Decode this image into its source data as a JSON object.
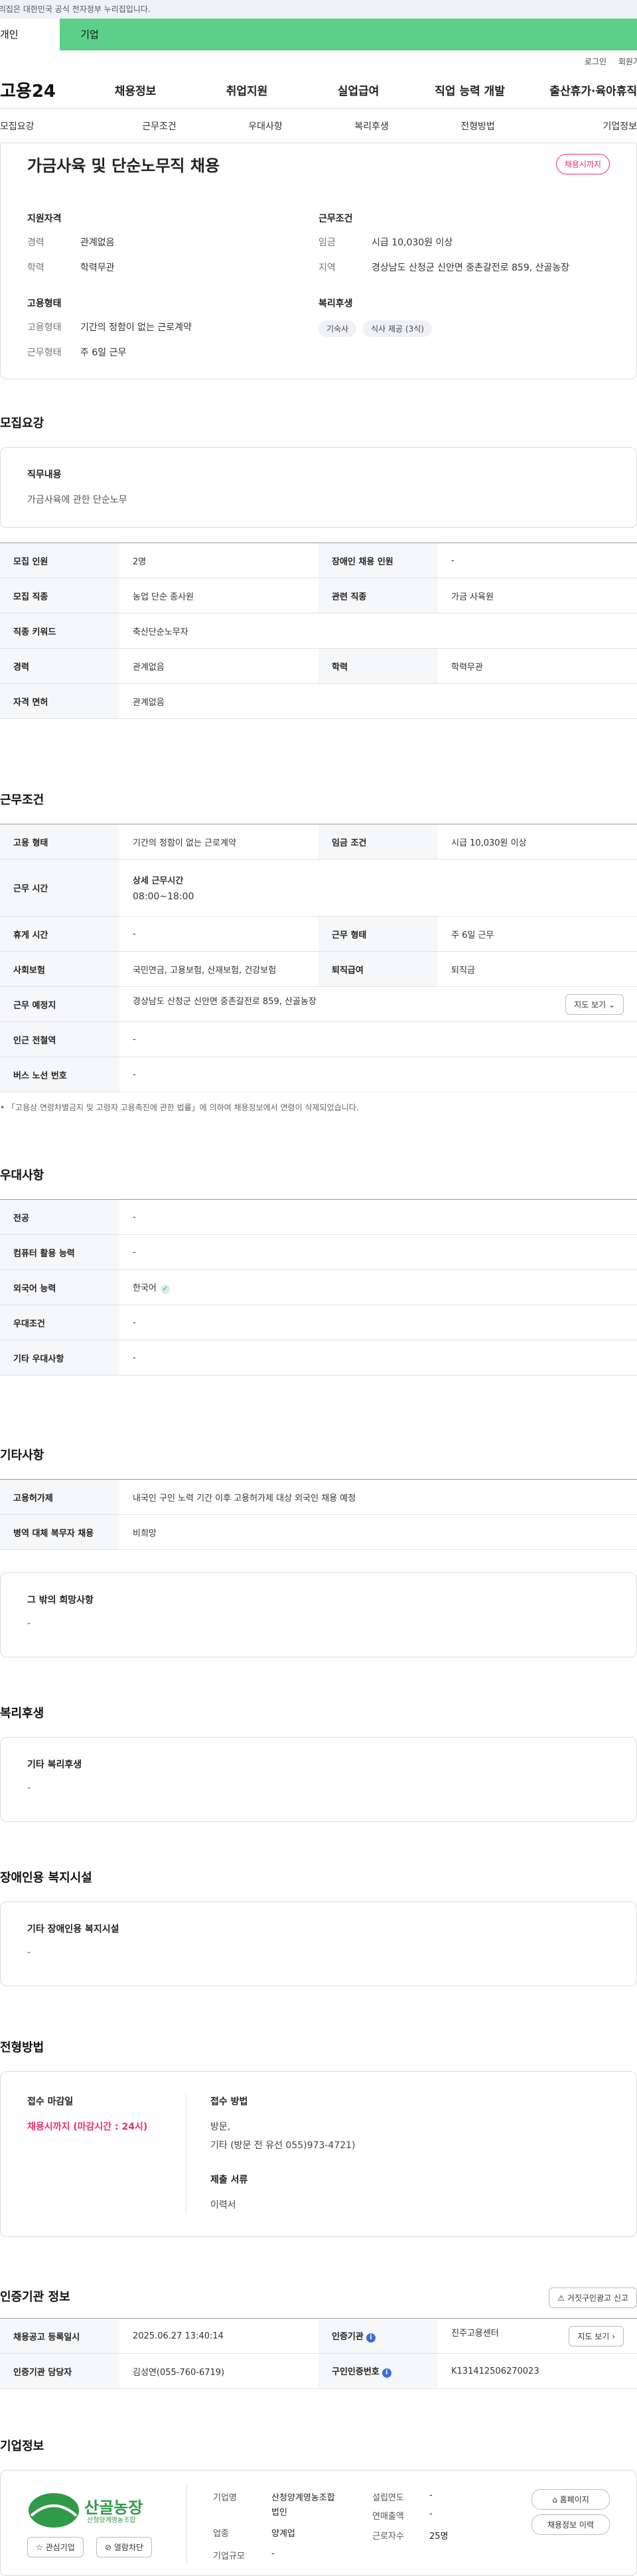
{
  "gov_banner": "이 누리집은 대한민국 공식 전자정부 누리집입니다.",
  "user_tabs": [
    "개인",
    "기업"
  ],
  "util_links": [
    "로그인",
    "회원가입"
  ],
  "logo": "고용24",
  "gnb": [
    "채용정보",
    "취업지원",
    "실업급여",
    "직업 능력 개발",
    "출산휴가·육아휴직"
  ],
  "subnav": [
    "모집요강",
    "근무조건",
    "우대사항",
    "복리후생",
    "전형방법",
    "기업정보"
  ],
  "summary": {
    "title": "가금사육 및 단순노무직 채용",
    "status": "채용시까지",
    "qual_head": "지원자격",
    "qual": [
      {
        "k": "경력",
        "v": "관계없음"
      },
      {
        "k": "학력",
        "v": "학력무관"
      }
    ],
    "emp_head": "고용형태",
    "emp": [
      {
        "k": "고용형태",
        "v": "기간의 정함이 없는 근로계약"
      },
      {
        "k": "근무형태",
        "v": "주 6일 근무"
      }
    ],
    "cond_head": "근무조건",
    "cond": [
      {
        "k": "임금",
        "v": "시급 10,030원 이상"
      },
      {
        "k": "지역",
        "v": "경상남도 산청군 신안면 중촌갈전로 859, 산골농장"
      }
    ],
    "welfare_head": "복리후생",
    "welfare_chips": [
      "기숙사",
      "식사 제공 (3식)"
    ]
  },
  "recruit": {
    "title": "모집요강",
    "duty_head": "직무내용",
    "duty_text": "가금사육에 관한 단순노무",
    "rows": [
      [
        "모집 인원",
        "2명",
        "장애인 채용 인원",
        "-"
      ],
      [
        "모집 직종",
        "농업 단순 종사원",
        "관련 직종",
        "가금 사육원"
      ],
      [
        "직종 키워드",
        "축산단순노무자",
        "",
        ""
      ],
      [
        "경력",
        "관계없음",
        "학력",
        "학력무관"
      ],
      [
        "자격 면허",
        "관계없음",
        "",
        ""
      ]
    ]
  },
  "work": {
    "title": "근무조건",
    "r1": [
      "고용 형태",
      "기간의 정함이 없는 근로계약",
      "임금 조건",
      "시급 10,030원 이상"
    ],
    "hours_k": "근무 시간",
    "hours_label": "상세 근무시간",
    "hours_value": "08:00~18:00",
    "r3": [
      "휴게 시간",
      "-",
      "근무 형태",
      "주 6일 근무"
    ],
    "r4": [
      "사회보험",
      "국민연금, 고용보험, 산재보험, 건강보험",
      "퇴직급여",
      "퇴직금"
    ],
    "place_k": "근무 예정지",
    "place_v": "경상남도 산청군 신안면 중촌갈전로 859, 산골농장",
    "map_btn": "지도 보기",
    "r6": [
      "인근 전철역",
      "-"
    ],
    "r7": [
      "버스 노선 번호",
      "-"
    ],
    "note": "「고용상 연령차별금지 및 고령자 고용촉진에 관한 법률」에 의하여 채용정보에서 연령이 삭제되었습니다."
  },
  "pref": {
    "title": "우대사항",
    "rows": [
      [
        "전공",
        "-"
      ],
      [
        "컴퓨터 활용 능력",
        "-"
      ],
      [
        "외국어 능력",
        "한국어"
      ],
      [
        "우대조건",
        "-"
      ],
      [
        "기타 우대사항",
        "-"
      ]
    ]
  },
  "other": {
    "title": "기타사항",
    "rows": [
      [
        "고용허가제",
        "내국인 구인 노력 기간 이후 고용허가제 대상 외국인 채용 예정"
      ],
      [
        "병역 대체 복무자 채용",
        "비희망"
      ]
    ],
    "extra_head": "그 밖의 희망사항",
    "extra_text": "-"
  },
  "welfare": {
    "title": "복리후생",
    "head": "기타 복리후생",
    "text": "-"
  },
  "disability": {
    "title": "장애인용 복지시설",
    "head": "기타 장애인용 복지시설",
    "text": "-"
  },
  "process": {
    "title": "전형방법",
    "deadline_head": "접수 마감일",
    "deadline": "채용시까지 (마감시간 : 24시)",
    "method_head": "접수 방법",
    "method1": "방문,",
    "method2": "기타 (방문 전 유선 055)973-4721)",
    "docs_head": "제출 서류",
    "docs": "이력서"
  },
  "cert": {
    "title": "인증기관 정보",
    "report_btn": "거짓구인광고 신고",
    "r1": [
      "채용공고 등록일시",
      "2025.06.27 13:40:14",
      "인증기관",
      "진주고용센터"
    ],
    "r2": [
      "인증기관 담당자",
      "김성연(055-760-6719)",
      "구인인증번호",
      "K131412506270023"
    ],
    "map_btn": "지도 보기"
  },
  "company": {
    "title": "기업정보",
    "logo_text": "산골농장",
    "logo_sub": "산청양계영농조합",
    "fav_btn": "관심기업",
    "block_btn": "열람차단",
    "name_k": "기업명",
    "name_v1": "산청양계영농조합",
    "name_v2": "법인",
    "year_k": "설립연도",
    "year_v": "-",
    "sales_k": "연매출액",
    "sales_v": "-",
    "ind_k": "업종",
    "ind_v": "양계업",
    "emp_k": "근로자수",
    "emp_v": "25명",
    "size_k": "기업규모",
    "size_v": "-",
    "home_btn": "홈페이지",
    "history_btn": "채용정보 이력"
  },
  "colors": {
    "accent_green": "#5ccf8a",
    "status_red": "#e6306b",
    "info_blue": "#3d6de0"
  }
}
